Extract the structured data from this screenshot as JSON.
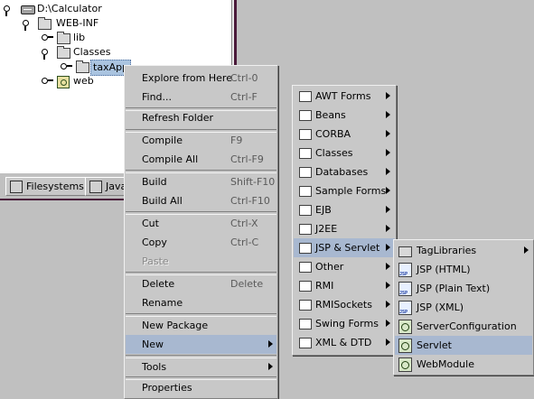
{
  "tree": {
    "nodes": [
      {
        "label": "D:\\Calculator",
        "icon": "drive-icon"
      },
      {
        "label": "WEB-INF",
        "icon": "folder-icon"
      },
      {
        "label": "lib",
        "icon": "folder-icon"
      },
      {
        "label": "Classes",
        "icon": "folder-icon"
      },
      {
        "label": "taxApp",
        "icon": "folder-icon",
        "selected": true
      },
      {
        "label": "web",
        "icon": "web-module-icon"
      }
    ]
  },
  "tabs": [
    {
      "label": "Filesystems",
      "icon": "filesystems-icon"
    },
    {
      "label": "Java",
      "icon": "javadoc-icon"
    }
  ],
  "context_menu": {
    "items": [
      {
        "label": "Explore from Here",
        "shortcut": "Ctrl-0"
      },
      {
        "label": "Find...",
        "shortcut": "Ctrl-F"
      },
      {
        "label": "Refresh Folder",
        "shortcut": ""
      },
      {
        "label": "Compile",
        "shortcut": "F9"
      },
      {
        "label": "Compile All",
        "shortcut": "Ctrl-F9"
      },
      {
        "label": "Build",
        "shortcut": "Shift-F10"
      },
      {
        "label": "Build All",
        "shortcut": "Ctrl-F10"
      },
      {
        "label": "Cut",
        "shortcut": "Ctrl-X"
      },
      {
        "label": "Copy",
        "shortcut": "Ctrl-C"
      },
      {
        "label": "Paste",
        "shortcut": "",
        "disabled": true
      },
      {
        "label": "Delete",
        "shortcut": "Delete"
      },
      {
        "label": "Rename",
        "shortcut": ""
      },
      {
        "label": "New Package",
        "shortcut": ""
      },
      {
        "label": "New",
        "shortcut": "",
        "submenu": true,
        "highlighted": true
      },
      {
        "label": "Tools",
        "shortcut": "",
        "submenu": true
      },
      {
        "label": "Properties",
        "shortcut": ""
      }
    ]
  },
  "new_submenu": {
    "items": [
      {
        "label": "AWT Forms"
      },
      {
        "label": "Beans"
      },
      {
        "label": "CORBA"
      },
      {
        "label": "Classes"
      },
      {
        "label": "Databases"
      },
      {
        "label": "Sample Forms"
      },
      {
        "label": "EJB"
      },
      {
        "label": "J2EE"
      },
      {
        "label": "JSP & Servlet",
        "highlighted": true
      },
      {
        "label": "Other"
      },
      {
        "label": "RMI"
      },
      {
        "label": "RMISockets"
      },
      {
        "label": "Swing Forms"
      },
      {
        "label": "XML & DTD"
      }
    ]
  },
  "jsp_submenu": {
    "items": [
      {
        "label": "TagLibraries",
        "icon": "folder-icon",
        "submenu": true
      },
      {
        "label": "JSP (HTML)",
        "icon": "jsp-file-icon"
      },
      {
        "label": "JSP (Plain Text)",
        "icon": "jsp-file-icon"
      },
      {
        "label": "JSP (XML)",
        "icon": "jsp-file-icon"
      },
      {
        "label": "ServerConfiguration",
        "icon": "server-config-icon"
      },
      {
        "label": "Servlet",
        "icon": "servlet-icon",
        "highlighted": true
      },
      {
        "label": "WebModule",
        "icon": "web-module-icon"
      }
    ]
  },
  "colors": {
    "menu_bg": "#c8c8c8",
    "highlight": "#a8b8d0",
    "selection": "#aac4e0"
  }
}
